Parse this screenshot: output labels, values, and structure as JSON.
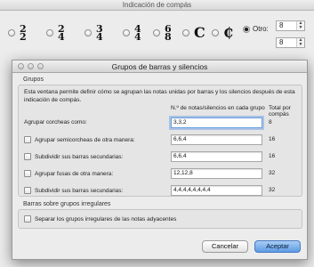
{
  "back_window": {
    "title": "Indicación de compás",
    "time_signatures": [
      {
        "num": "2",
        "den": "2"
      },
      {
        "num": "2",
        "den": "4"
      },
      {
        "num": "3",
        "den": "4"
      },
      {
        "num": "4",
        "den": "4"
      },
      {
        "num": "6",
        "den": "8"
      }
    ],
    "common_time_symbol": "C",
    "cut_time_symbol": "₵",
    "other_label": "Otro:",
    "other_numerator": "8",
    "other_denominator": "8"
  },
  "dialog": {
    "title": "Grupos de barras y silencios",
    "groups_section": {
      "label": "Grupos",
      "description": "Esta ventana permite definir cómo se agrupan las notas unidas por barras y los silencios después de esta indicación de compás.",
      "column_notes": "N.º de notas/silencios en cada grupo",
      "column_total": "Total por compás",
      "rows": [
        {
          "label": "Agrupar corcheas como:",
          "value": "3,3,2",
          "total": "8",
          "has_checkbox": false
        },
        {
          "label": "Agrupar semicorcheas de otra manera:",
          "value": "6,6,4",
          "total": "16",
          "has_checkbox": true
        },
        {
          "label": "Subdividir sus barras secundarias:",
          "value": "6,6,4",
          "total": "16",
          "has_checkbox": true
        },
        {
          "label": "Agrupar fusas de otra manera:",
          "value": "12,12,8",
          "total": "32",
          "has_checkbox": true
        },
        {
          "label": "Subdividir sus barras secundarias:",
          "value": "4,4,4,4,4,4,4,4",
          "total": "32",
          "has_checkbox": true
        }
      ]
    },
    "irregular_section": {
      "label": "Barras sobre grupos irregulares",
      "checkbox_label": "Separar los grupos irregulares de las notas adyacentes"
    },
    "buttons": {
      "cancel": "Cancelar",
      "accept": "Aceptar"
    }
  }
}
